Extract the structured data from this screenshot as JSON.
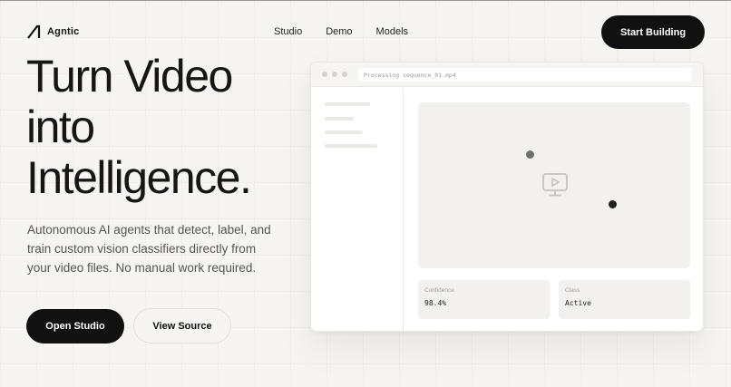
{
  "brand": {
    "name": "Agntic"
  },
  "nav": {
    "items": [
      "Studio",
      "Demo",
      "Models"
    ]
  },
  "header": {
    "cta_label": "Start Building"
  },
  "hero": {
    "title_lines": [
      "Turn Video",
      "into",
      "Intelligence."
    ],
    "subtitle": "Autonomous AI agents that detect, label, and train custom vision classifiers directly from your video files. No manual work required.",
    "primary_label": "Open Studio",
    "secondary_label": "View Source"
  },
  "app_window": {
    "address": "Processing sequence_01.mp4",
    "stats": [
      {
        "label": "Confidence",
        "value": "98.4%"
      },
      {
        "label": "Class",
        "value": "Active"
      }
    ],
    "icons": [
      "video-play-icon"
    ]
  },
  "colors": {
    "primary": "#111111",
    "background": "#f7f5f2",
    "surface": "#ffffff",
    "canvas": "#f2f1ef"
  }
}
